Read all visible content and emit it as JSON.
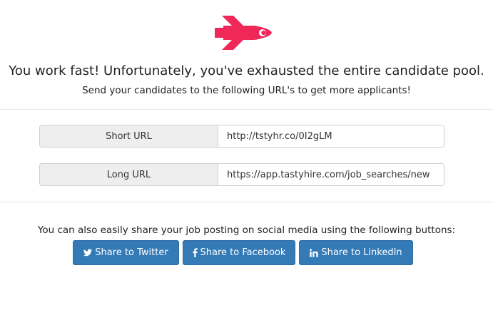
{
  "hero": {
    "icon": "rocket-icon",
    "accent_color": "#f0285a",
    "headline": "You work fast! Unfortunately, you've exhausted the entire candidate pool.",
    "subline": "Send your candidates to the following URL's to get more applicants!"
  },
  "urls": {
    "short": {
      "label": "Short URL",
      "value": "http://tstyhr.co/0I2gLM"
    },
    "long": {
      "label": "Long URL",
      "value": "https://app.tastyhire.com/job_searches/new"
    }
  },
  "share": {
    "text": "You can also easily share your job posting on social media using the following buttons:",
    "button_color": "#337ab7",
    "twitter": {
      "icon": "twitter-icon",
      "label": "Share to Twitter"
    },
    "facebook": {
      "icon": "facebook-icon",
      "label": "Share to Facebook"
    },
    "linkedin": {
      "icon": "linkedin-icon",
      "label": "Share to LinkedIn"
    }
  }
}
